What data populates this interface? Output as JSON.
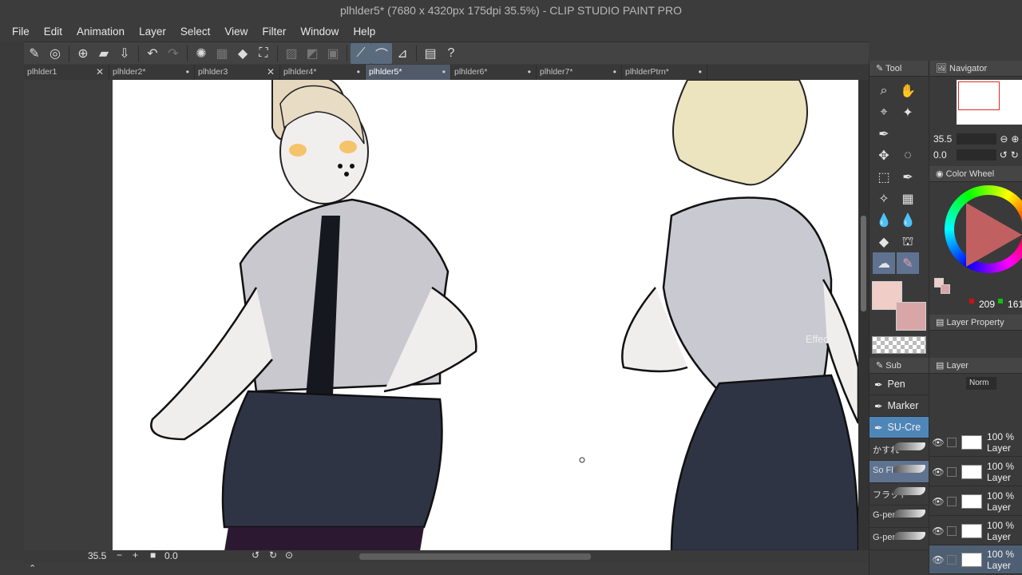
{
  "window": {
    "title": "plhlder5* (7680 x 4320px 175dpi 35.5%) - CLIP STUDIO PAINT PRO"
  },
  "menu": [
    "File",
    "Edit",
    "Animation",
    "Layer",
    "Select",
    "View",
    "Filter",
    "Window",
    "Help"
  ],
  "tabs": [
    {
      "label": "plhlder1",
      "mark": "✕"
    },
    {
      "label": "plhlder2*",
      "mark": "•"
    },
    {
      "label": "plhlder3",
      "mark": "✕"
    },
    {
      "label": "plhlder4*",
      "mark": "•"
    },
    {
      "label": "plhlder5*",
      "mark": "•"
    },
    {
      "label": "plhlder6*",
      "mark": "•"
    },
    {
      "label": "plhlder7*",
      "mark": "•"
    },
    {
      "label": "plhlderPtrn*",
      "mark": "•"
    }
  ],
  "status": {
    "zoom": "35.5",
    "rotation": "0.0"
  },
  "panels": {
    "tool_tab": "Tool",
    "sub_tab": "Sub",
    "navigator_tab": "Navigator",
    "color_wheel_tab": "Color Wheel",
    "layer_property_tab": "Layer Property",
    "layer_tab": "Layer",
    "effect_label": "Effect",
    "blend_mode": "Norm"
  },
  "navigator": {
    "zoom": "35.5",
    "rotation": "0.0"
  },
  "color": {
    "r": "209",
    "g": "161",
    "main": "#f0cdc6",
    "sub": "#d9a6a8"
  },
  "subtools": [
    "Pen",
    "Marker",
    "SU-Cre"
  ],
  "brushes": [
    "かすれ",
    "So Fl",
    "フラット",
    "G-per",
    "G-per"
  ],
  "layers": [
    {
      "opacity": "100 %",
      "name": "Layer"
    },
    {
      "opacity": "100 %",
      "name": "Layer"
    },
    {
      "opacity": "100 %",
      "name": "Layer"
    },
    {
      "opacity": "100 %",
      "name": "Layer"
    },
    {
      "opacity": "100 %",
      "name": "Layer"
    }
  ]
}
